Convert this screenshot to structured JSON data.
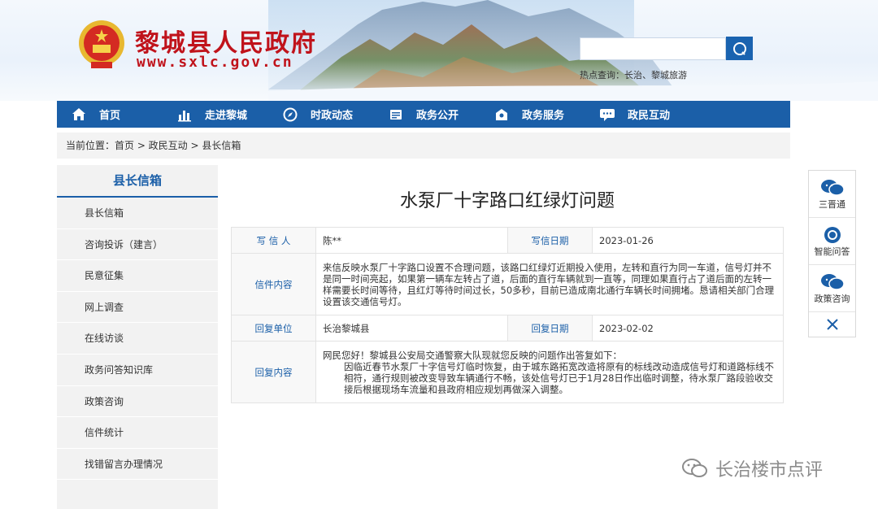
{
  "header": {
    "site_title": "黎城县人民政府",
    "site_url": "www.sxlc.gov.cn",
    "search_placeholder": "",
    "hot_search": "热点查询：长治、黎城旅游"
  },
  "nav": {
    "items": [
      {
        "label": "首页",
        "icon": "home-icon"
      },
      {
        "label": "走进黎城",
        "icon": "chart-icon"
      },
      {
        "label": "时政动态",
        "icon": "compass-icon"
      },
      {
        "label": "政务公开",
        "icon": "card-icon"
      },
      {
        "label": "政务服务",
        "icon": "service-icon"
      },
      {
        "label": "政民互动",
        "icon": "chat-icon"
      }
    ]
  },
  "breadcrumb": "当前位置：首页 > 政民互动 > 县长信箱",
  "sidebar": {
    "title": "县长信箱",
    "items": [
      {
        "label": "县长信箱"
      },
      {
        "label": "咨询投诉（建言）"
      },
      {
        "label": "民意征集"
      },
      {
        "label": "网上调查"
      },
      {
        "label": "在线访谈"
      },
      {
        "label": "政务问答知识库"
      },
      {
        "label": "政策咨询"
      },
      {
        "label": "信件统计"
      },
      {
        "label": "找错留言办理情况"
      }
    ]
  },
  "letter": {
    "title": "水泵厂十字路口红绿灯问题",
    "writer_label": "写 信 人",
    "writer": "陈**",
    "date_label": "写信日期",
    "date": "2023-01-26",
    "content_label": "信件内容",
    "content": "来信反映水泵厂十字路口设置不合理问题，该路口红绿灯近期投入使用，左转和直行为同一车道，信号灯并不是同一时间亮起，如果第一辆车左转占了道，后面的直行车辆就到一直等，同理如果直行占了道后面的左转一样需要长时间等待，且红灯等待时间过长，50多秒，目前已造成南北通行车辆长时间拥堵。恳请相关部门合理设置该交通信号灯。",
    "reply_unit_label": "回复单位",
    "reply_unit": "长治黎城县",
    "reply_date_label": "回复日期",
    "reply_date": "2023-02-02",
    "reply_content_label": "回复内容",
    "reply_line1": "网民您好！黎城县公安局交通警察大队现就您反映的问题作出答复如下：",
    "reply_line2": "因临近春节水泵厂十字信号灯临时恢复，由于城东路拓宽改造将原有的标线改动造成信号灯和道路标线不相符，通行规则被改变导致车辆通行不畅，该处信号灯已于1月28日作出临时调整，待水泵厂路段验收交接后根据现场车流量和县政府相应规划再做深入调整。"
  },
  "float_bar": {
    "items": [
      {
        "label": "三晋通",
        "icon": "wechat-icon"
      },
      {
        "label": "智能问答",
        "icon": "qa-icon"
      },
      {
        "label": "政策咨询",
        "icon": "consult-icon"
      }
    ]
  },
  "watermark": "长治楼市点评",
  "colors": {
    "brand_red": "#c0131b",
    "nav_blue": "#1b5fa8"
  }
}
